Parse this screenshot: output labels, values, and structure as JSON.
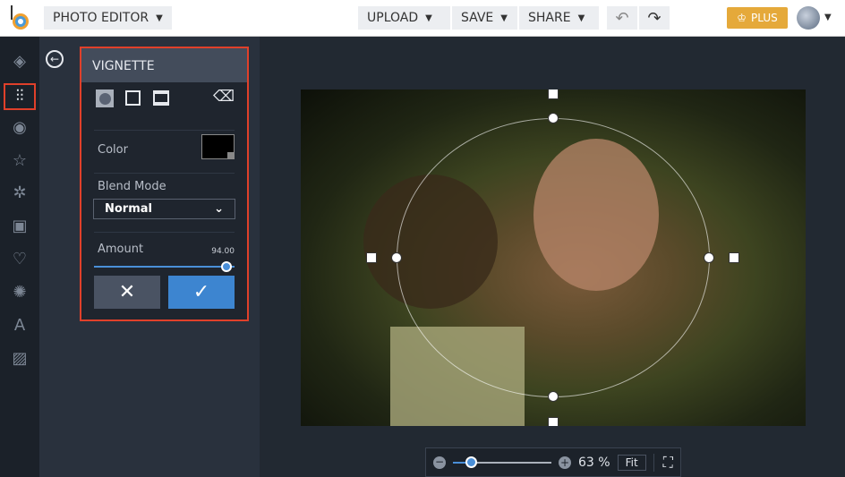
{
  "header": {
    "app_menu": "PHOTO EDITOR",
    "upload": "UPLOAD",
    "save": "SAVE",
    "share": "SHARE",
    "plus": "PLUS"
  },
  "sidebar": {
    "items": [
      "layers",
      "adjustments",
      "eye",
      "star",
      "badge",
      "frame",
      "heart",
      "sticker",
      "text",
      "texture"
    ],
    "active": "adjustments"
  },
  "panel": {
    "title": "VIGNETTE",
    "color_label": "Color",
    "color_value": "#000000",
    "blend_label": "Blend Mode",
    "blend_value": "Normal",
    "amount_label": "Amount",
    "amount_value": "94.00",
    "amount_percent": 94
  },
  "zoom": {
    "value": "63 %",
    "fit": "Fit",
    "slider_percent": 18
  }
}
